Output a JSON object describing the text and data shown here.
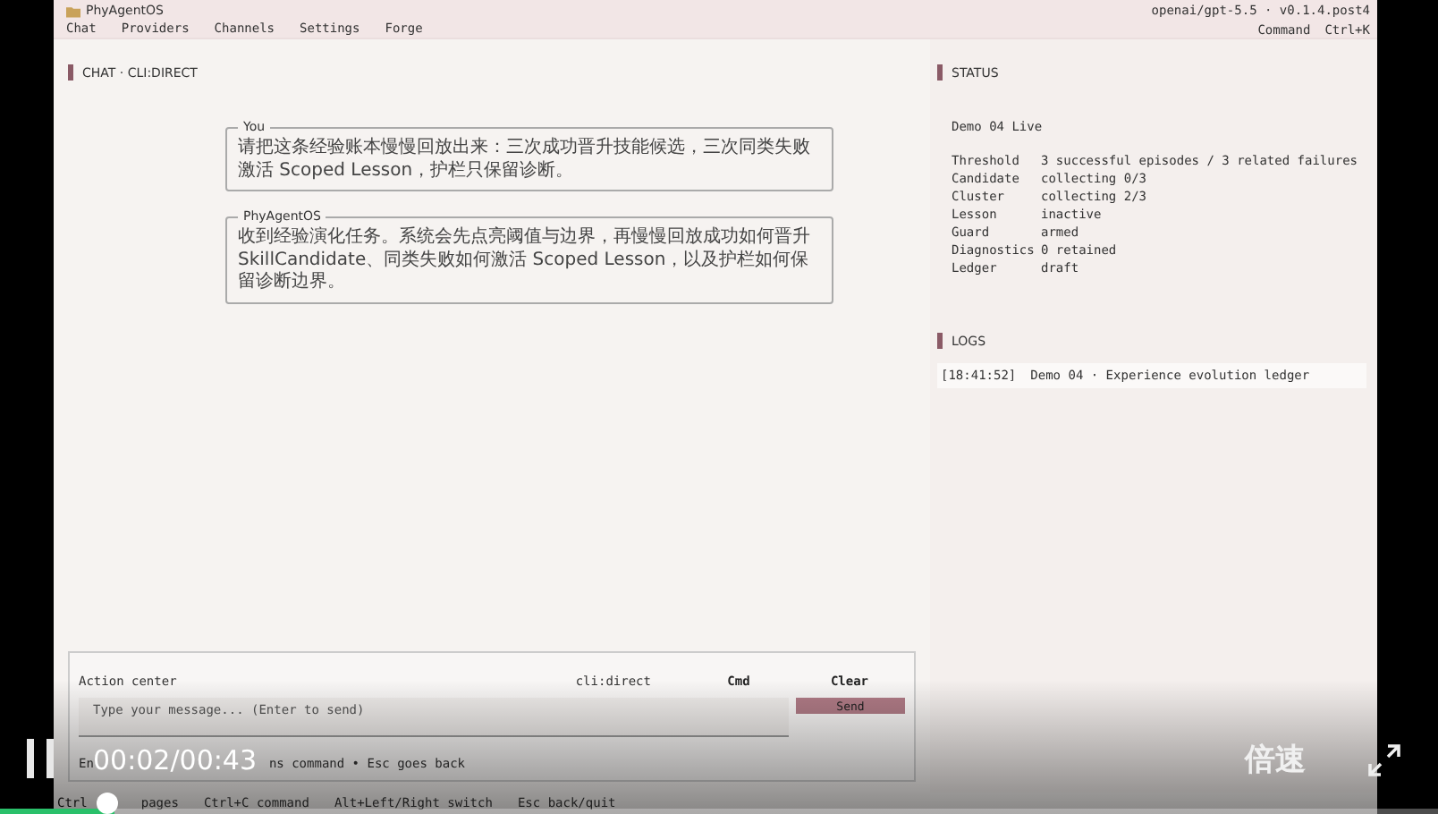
{
  "topbar": {
    "app_name": "PhyAgentOS",
    "nav": [
      "Chat",
      "Providers",
      "Channels",
      "Settings",
      "Forge"
    ],
    "model": "openai/gpt-5.5 · v0.1.4.post4",
    "shortcuts": [
      "Command",
      "Ctrl+K"
    ]
  },
  "chat": {
    "title": "CHAT · CLI:DIRECT",
    "messages": [
      {
        "sender": "You",
        "text": "请把这条经验账本慢慢回放出来：三次成功晋升技能候选，三次同类失败激活 Scoped Lesson，护栏只保留诊断。"
      },
      {
        "sender": "PhyAgentOS",
        "text": "收到经验演化任务。系统会先点亮阈值与边界，再慢慢回放成功如何晋升 SkillCandidate、同类失败如何激活 Scoped Lesson，以及护栏如何保留诊断边界。"
      }
    ]
  },
  "action_center": {
    "title": "Action center",
    "channel": "cli:direct",
    "buttons": [
      "Cmd",
      "Clear"
    ],
    "placeholder": "Type your message... (Enter to send)",
    "send": "Send",
    "hint_parts": [
      "En",
      "ns command  •  Esc goes back"
    ]
  },
  "status": {
    "title": "STATUS",
    "headline": "Demo 04 Live",
    "rows": [
      {
        "key": "Threshold",
        "value": "3 successful episodes / 3 related failures"
      },
      {
        "key": "Candidate",
        "value": "collecting 0/3"
      },
      {
        "key": "Cluster",
        "value": "collecting 2/3"
      },
      {
        "key": "Lesson",
        "value": "inactive"
      },
      {
        "key": "Guard",
        "value": "armed"
      },
      {
        "key": "Diagnostics",
        "value": "0 retained"
      },
      {
        "key": "Ledger",
        "value": "draft"
      }
    ]
  },
  "logs": {
    "title": "LOGS",
    "entries": [
      {
        "time": "[18:41:52]",
        "text": "Demo 04 · Experience evolution ledger"
      }
    ]
  },
  "footer": {
    "hints": [
      "Ctrl",
      "pages",
      "Ctrl+C command",
      "Alt+Left/Right switch",
      "Esc back/quit"
    ]
  },
  "player": {
    "time": "00:02/00:43",
    "speed": "倍速",
    "level": 0.08
  }
}
